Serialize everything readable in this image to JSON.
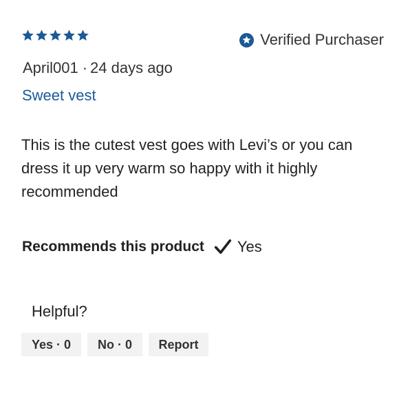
{
  "review": {
    "rating": 5,
    "rating_max": 5,
    "star_color": "#1a5a96",
    "verified_label": "Verified Purchaser",
    "author": "April001",
    "separator": "·",
    "posted": "24 days ago",
    "title": "Sweet vest",
    "body": "This is the cutest vest goes with Levi’s or you can dress it up very warm so happy with it highly recommended",
    "recommend_label": "Recommends this product",
    "recommend_value": "Yes"
  },
  "helpful": {
    "label": "Helpful?",
    "yes_label": "Yes · 0",
    "no_label": "No · 0",
    "report_label": "Report"
  },
  "icons": {
    "star": "star-icon",
    "verified": "verified-badge-icon",
    "check": "checkmark-icon"
  }
}
